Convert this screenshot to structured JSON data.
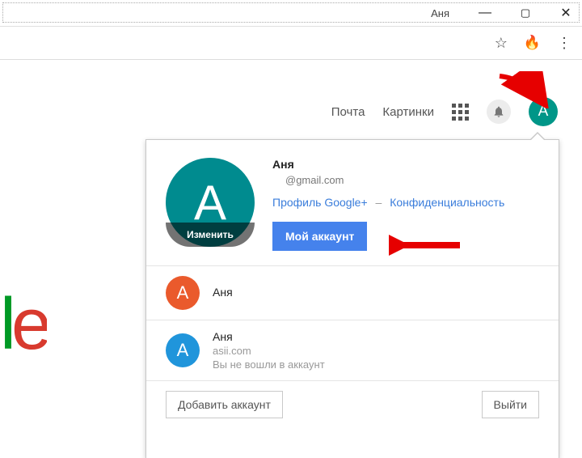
{
  "window": {
    "title": "Аня"
  },
  "header": {
    "mail": "Почта",
    "images": "Картинки",
    "avatar_initial": "А"
  },
  "popup": {
    "avatar_initial": "А",
    "avatar_edit": "Изменить",
    "name": "Аня",
    "email": "@gmail.com",
    "profile_link": "Профиль Google+",
    "privacy_link": "Конфиденциальность",
    "my_account": "Мой аккаунт",
    "accounts": [
      {
        "initial": "А",
        "name": "Аня",
        "sub": "",
        "color": "orange"
      },
      {
        "initial": "А",
        "name": "Аня",
        "sub": "asii.com",
        "note": "Вы не вошли в аккаунт",
        "color": "blue"
      }
    ],
    "add_account": "Добавить аккаунт",
    "sign_out": "Выйти"
  }
}
